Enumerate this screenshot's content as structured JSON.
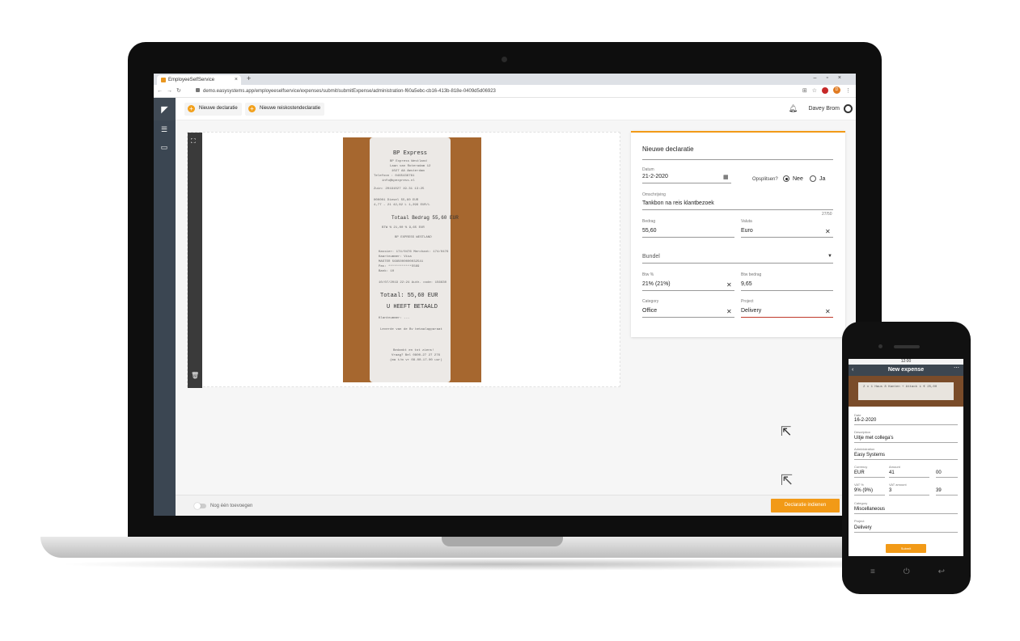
{
  "browser": {
    "tab_title": "EmployeeSelfService",
    "url": "demo.easysystems.app/employeeselfservice/expenses/submit/submitExpense/administration-f60a5ebc-cb16-413b-818e-0409d5d06923",
    "avatar_letter": "D"
  },
  "toolbar": {
    "new_declaration": "Nieuwe declaratie",
    "new_travel_declaration": "Nieuwe reiskostendeclaratie",
    "user_name": "Davey Brom"
  },
  "receipt": {
    "lines": [
      "BP Express",
      "BP Express Westland",
      "Laan van Roteradam 12",
      "1027 AA Amsterdam",
      "Telefoon : 0465436761",
      "info@bpexpress.nl",
      "Zuin: 20191027 19.31 13:25",
      "000001 Diesel        55,60 EUR",
      "4,77 - 21      42,82 L   1,299 EUR/L",
      "Totaal Bedrag       55,60 EUR",
      "BTW %       21,00 %   9,65 EUR",
      "BP EXPRESS WESTLAND",
      "Kassier: 174/0476  Merchant: 174/0476",
      "Kaartnummer: Visa",
      "MASTER 5685000000032541",
      "Pas: ************5569",
      "Bank: 10",
      "10/07/2019 22:24    Auth. code: 156630",
      "Totaal:      55,60 EUR",
      "U HEEFT BETAALD",
      "Klantnummer: ---",
      "Leverde van de Bv betaalapparaat",
      "Bedankt en tot ziens!",
      "Vraag? Bel 0800-27 27 276",
      "(ma t/m vr 08.00-17.00 uur)"
    ]
  },
  "form": {
    "title": "Nieuwe declaratie",
    "date_label": "Datum",
    "date_value": "21-2-2020",
    "split_label": "Opsplitsen?",
    "radio_no": "Nee",
    "radio_yes": "Ja",
    "description_label": "Omschrijving",
    "description_value": "Tankbon na reis klantbezoek",
    "char_count": "27/50",
    "amount_label": "Bedrag",
    "amount_value": "55,60",
    "currency_label": "Valuta",
    "currency_value": "Euro",
    "bundle_placeholder": "Bundel",
    "vat_pct_label": "Btw %",
    "vat_pct_value": "21% (21%)",
    "vat_amount_label": "Btw bedrag",
    "vat_amount_value": "9,65",
    "category_label": "Category",
    "category_value": "Office",
    "project_label": "Project",
    "project_value": "Delivery"
  },
  "footer": {
    "toggle_label": "Nog één toevoegen",
    "submit_label": "Declaratie indienen"
  },
  "phone": {
    "status_time": "12:00",
    "title": "New expense",
    "receipt_text": "2 x 1 Haus 8 Kanten + Attack i",
    "receipt_price": "€ 25,00",
    "date_label": "Date",
    "date_value": "16-2-2020",
    "description_label": "Description",
    "description_value": "Uitje met collega's",
    "administration_label": "Administration",
    "administration_value": "Easy Systems",
    "currency_label": "Currency",
    "currency_value": "EUR",
    "amount_label": "Amount",
    "amount_value": "41",
    "amount_cents": "00",
    "vat_pct_label": "VAT %",
    "vat_pct_value": "9% (9%)",
    "vat_amount_label": "VAT amount",
    "vat_amount_value": "3",
    "vat_amount_cents": "39",
    "category_label": "Category",
    "category_value": "Miscellaneous",
    "project_label": "Project",
    "project_value": "Delivery",
    "submit_label": "Submit"
  }
}
